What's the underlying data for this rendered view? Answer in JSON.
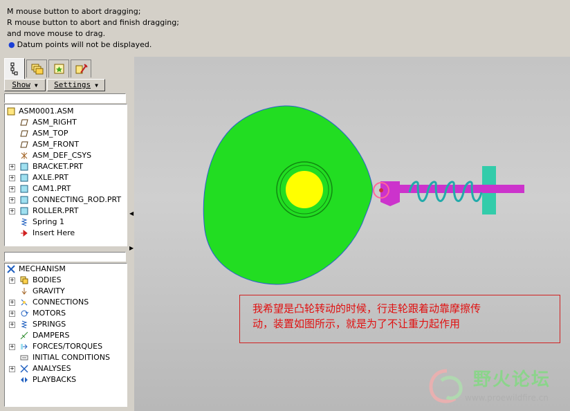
{
  "message_area": {
    "lines": [
      "M mouse button to abort dragging;",
      "R mouse button to abort and finish dragging;",
      "and move mouse to drag."
    ],
    "info_bullet": "●",
    "info": "Datum points will not be displayed."
  },
  "panel": {
    "tabs": [
      {
        "icon": "model-tree-icon",
        "active": true
      },
      {
        "icon": "layers-icon",
        "active": false
      },
      {
        "icon": "favorites-icon",
        "active": false
      },
      {
        "icon": "tools-icon",
        "active": false
      }
    ],
    "show_button": "Show",
    "settings_button": "Settings",
    "dropdown_arrow": "▼"
  },
  "model_tree": {
    "root": "ASM0001.ASM",
    "items": [
      {
        "label": "ASM_RIGHT",
        "icon": "datum-plane-icon",
        "expandable": false
      },
      {
        "label": "ASM_TOP",
        "icon": "datum-plane-icon",
        "expandable": false
      },
      {
        "label": "ASM_FRONT",
        "icon": "datum-plane-icon",
        "expandable": false
      },
      {
        "label": "ASM_DEF_CSYS",
        "icon": "csys-icon",
        "expandable": false
      },
      {
        "label": "BRACKET.PRT",
        "icon": "part-icon",
        "expandable": true
      },
      {
        "label": "AXLE.PRT",
        "icon": "part-icon",
        "expandable": true
      },
      {
        "label": "CAM1.PRT",
        "icon": "part-icon",
        "expandable": true
      },
      {
        "label": "CONNECTING_ROD.PRT",
        "icon": "part-icon",
        "expandable": true
      },
      {
        "label": "ROLLER.PRT",
        "icon": "part-icon",
        "expandable": true
      },
      {
        "label": "Spring 1",
        "icon": "spring-icon",
        "expandable": false
      },
      {
        "label": "Insert Here",
        "icon": "insert-arrow-icon",
        "expandable": false
      }
    ]
  },
  "mechanism_tree": {
    "root": "MECHANISM",
    "items": [
      {
        "label": "BODIES",
        "icon": "bodies-icon",
        "expandable": true
      },
      {
        "label": "GRAVITY",
        "icon": "gravity-icon",
        "expandable": false
      },
      {
        "label": "CONNECTIONS",
        "icon": "connections-icon",
        "expandable": true
      },
      {
        "label": "MOTORS",
        "icon": "motors-icon",
        "expandable": true
      },
      {
        "label": "SPRINGS",
        "icon": "springs-icon",
        "expandable": true
      },
      {
        "label": "DAMPERS",
        "icon": "dampers-icon",
        "expandable": false
      },
      {
        "label": "FORCES/TORQUES",
        "icon": "forces-icon",
        "expandable": true
      },
      {
        "label": "INITIAL CONDITIONS",
        "icon": "initial-conditions-icon",
        "expandable": false
      },
      {
        "label": "ANALYSES",
        "icon": "analyses-icon",
        "expandable": true
      },
      {
        "label": "PLAYBACKS",
        "icon": "playbacks-icon",
        "expandable": false
      }
    ]
  },
  "viewport": {
    "cam_color": "#22dd22",
    "hub_color": "#ffff00",
    "rod_color": "#cc33cc",
    "spring_color": "#22aaaa",
    "guide_color": "#33ccaa",
    "roller_color": "#ff6699"
  },
  "annotation": {
    "line1": "我希望是凸轮转动的时候，行走轮跟着动靠摩擦传",
    "line2": "动，装置如图所示，就是为了不让重力起作用"
  },
  "watermark": {
    "title": "野火论坛",
    "url": "www.proewildfire.cn"
  }
}
